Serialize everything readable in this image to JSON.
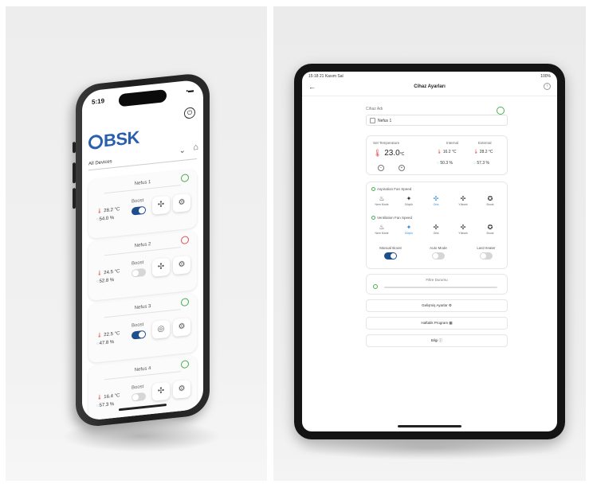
{
  "phone": {
    "time": "5:19",
    "logo": "BSK",
    "device_selector": "All Devices",
    "cards": [
      {
        "name": "Nefus 1",
        "power_color": "#4caf50",
        "temp": "28.2 °C",
        "hum": "54.0 %",
        "boost_label": "Boost",
        "boost_on": true,
        "fan_icon": "✣",
        "gear_icon": "⚙"
      },
      {
        "name": "Nefus 2",
        "power_color": "#e05757",
        "temp": "24.5 °C",
        "hum": "52.8 %",
        "boost_label": "Boost",
        "boost_on": false,
        "fan_icon": "✣",
        "gear_icon": "⚙"
      },
      {
        "name": "Nefus 3",
        "power_color": "#4caf50",
        "temp": "22.5 °C",
        "hum": "47.8 %",
        "boost_label": "Boost",
        "boost_on": true,
        "fan_icon": "◎",
        "gear_icon": "⚙"
      },
      {
        "name": "Nefus 4",
        "power_color": "#4caf50",
        "temp": "16.4 °C",
        "hum": "57.3 %",
        "boost_label": "Boost",
        "boost_on": false,
        "fan_icon": "✣",
        "gear_icon": "⚙"
      }
    ]
  },
  "tablet": {
    "status_left": "15:18 21 Kasım Sal",
    "status_right": "100%",
    "back_icon": "←",
    "title": "Cihaz Ayarları",
    "info_icon": "i",
    "device_name_label": "Cihaz Adı",
    "device_name": "Nefus 1",
    "set_temperature_label": "Set Temperature",
    "set_temperature": "23.0",
    "set_temperature_unit": "°C",
    "internal_label": "Internal",
    "internal_temp": "16.2 °C",
    "internal_hum": "50.3 %",
    "external_label": "External",
    "external_temp": "28.2 °C",
    "external_hum": "57.3 %",
    "aspiration_label": "Aspiration Fan Speed",
    "ventilation_label": "Ventilation Fan Speed",
    "aspiration_modes": [
      {
        "icon": "♨",
        "label": "Nem Mode",
        "on": false
      },
      {
        "icon": "✦",
        "label": "Düşük",
        "on": false
      },
      {
        "icon": "✣",
        "label": "Orta",
        "on": true
      },
      {
        "icon": "✣",
        "label": "Yüksek",
        "on": false
      },
      {
        "icon": "✪",
        "label": "Boost",
        "on": false
      }
    ],
    "ventilation_modes": [
      {
        "icon": "♨",
        "label": "Nem Mode",
        "on": false
      },
      {
        "icon": "✦",
        "label": "Düşük",
        "on": true
      },
      {
        "icon": "✣",
        "label": "Orta",
        "on": false
      },
      {
        "icon": "✣",
        "label": "Yüksek",
        "on": false
      },
      {
        "icon": "✪",
        "label": "Boost",
        "on": false
      }
    ],
    "switches": [
      {
        "label": "Manual Boost",
        "on": true
      },
      {
        "label": "Auto Mode",
        "on": false
      },
      {
        "label": "Last Heater",
        "on": false
      }
    ],
    "filter_label": "Filtre Durumu",
    "menu": [
      {
        "label": "Gelişmiş Ayarlar",
        "icon": "⚙"
      },
      {
        "label": "Haftalık Program",
        "icon": "▦"
      },
      {
        "label": "Bilgi",
        "icon": "ⓘ"
      }
    ],
    "colors": {
      "accent": "#2a5fb0",
      "power_on": "#4caf50",
      "toggle_on": "#1f4e8c",
      "toggle_off": "#d6d6d6"
    }
  }
}
